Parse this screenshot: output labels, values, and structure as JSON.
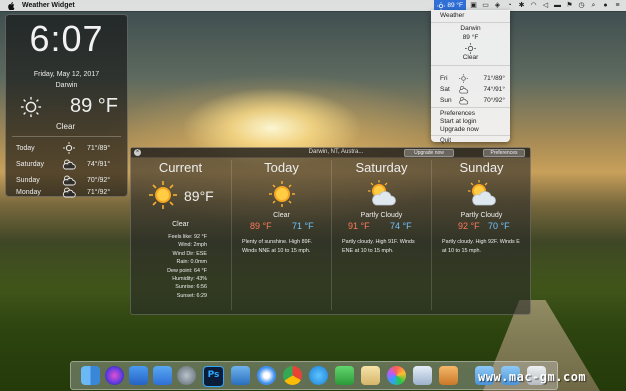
{
  "menubar": {
    "app_name": "Weather Widget",
    "weather_temp": "89 °F"
  },
  "widget": {
    "time": "6:07",
    "date": "Friday, May 12, 2017",
    "city": "Darwin",
    "temp": "89 °F",
    "condition": "Clear",
    "forecast": [
      {
        "day": "Today",
        "range": "71°/89°",
        "icon": "sun-icon"
      },
      {
        "day": "Saturday",
        "range": "74°/91°",
        "icon": "partly-cloudy-icon"
      },
      {
        "day": "Sunday",
        "range": "70°/92°",
        "icon": "partly-cloudy-icon"
      },
      {
        "day": "Monday",
        "range": "71°/92°",
        "icon": "partly-cloudy-icon"
      }
    ]
  },
  "menu": {
    "header": "Weather",
    "city": "Darwin",
    "temp": "89 °F",
    "condition": "Clear",
    "forecast": [
      {
        "day": "Fri",
        "range": "71°/89°"
      },
      {
        "day": "Sat",
        "range": "74°/91°"
      },
      {
        "day": "Sun",
        "range": "70°/92°"
      }
    ],
    "items": [
      "Preferences",
      "Start at login",
      "Upgrade now",
      "Quit"
    ]
  },
  "panel": {
    "title": "Darwin, NT, Austra...",
    "upgrade_label": "Upgrade now",
    "preferences_label": "Preferences",
    "current": {
      "heading": "Current",
      "temp": "89°F",
      "condition": "Clear",
      "details": [
        "Feels like: 92 °F",
        "Wind: 2mph",
        "Wind Dir: ESE",
        "Rain: 0.0mm",
        "Dew point: 64 °F",
        "Humidity: 43%",
        "Sunrise: 6:56",
        "Sunset: 6:29"
      ]
    },
    "days": [
      {
        "heading": "Today",
        "condition": "Clear",
        "hi": "89 °F",
        "lo": "71 °F",
        "desc": "Plenty of sunshine. High 89F. Winds NNE at 10 to 15 mph.",
        "icon": "sun-icon"
      },
      {
        "heading": "Saturday",
        "condition": "Partly Cloudy",
        "hi": "91 °F",
        "lo": "74 °F",
        "desc": "Partly cloudy. High 91F. Winds ENE at 10 to 15 mph.",
        "icon": "partly-cloudy-icon"
      },
      {
        "heading": "Sunday",
        "condition": "Partly Cloudy",
        "hi": "92 °F",
        "lo": "70 °F",
        "desc": "Partly cloudy. High 92F. Winds E at 10 to 15 mph.",
        "icon": "partly-cloudy-icon"
      }
    ]
  },
  "watermark": "www.mac-gm.com",
  "colors": {
    "hi": "#ff7a5a",
    "lo": "#6fc4ff",
    "menubar_accent": "#2f6fd6"
  }
}
